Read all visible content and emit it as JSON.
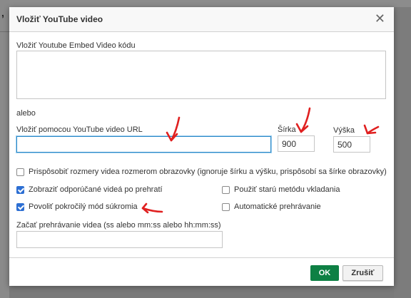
{
  "background": {
    "fragment": ","
  },
  "dialog": {
    "title": "Vložiť YouTube video",
    "close_symbol": "✕",
    "embed_label": "Vložiť Youtube Embed Video kódu",
    "embed_value": "",
    "or_text": "alebo",
    "url_label": "Vložiť pomocou YouTube video URL",
    "url_value": "",
    "width_label": "Šírka",
    "width_value": "900",
    "height_label": "Výška",
    "height_value": "500",
    "checkboxes": [
      {
        "label": "Prispôsobiť rozmery videa rozmerom obrazovky (ignoruje šírku a výšku, prispôsobí sa šírke obrazovky)",
        "checked": false
      },
      {
        "label": "Zobraziť odporúčané videá po prehratí",
        "checked": true
      },
      {
        "label": "Použiť starú metódu vkladania",
        "checked": false
      },
      {
        "label": "Povoliť pokročilý mód súkromia",
        "checked": true
      },
      {
        "label": "Automatické prehrávanie",
        "checked": false
      }
    ],
    "start_label": "Začať prehrávanie videa (ss alebo mm:ss alebo hh:mm:ss)",
    "start_value": "",
    "ok_label": "OK",
    "cancel_label": "Zrušiť"
  },
  "colors": {
    "ok_button": "#0e8044",
    "focus_border": "#2d8ac7",
    "checkbox_checked": "#2d6fd3",
    "annotation": "#e02020"
  }
}
